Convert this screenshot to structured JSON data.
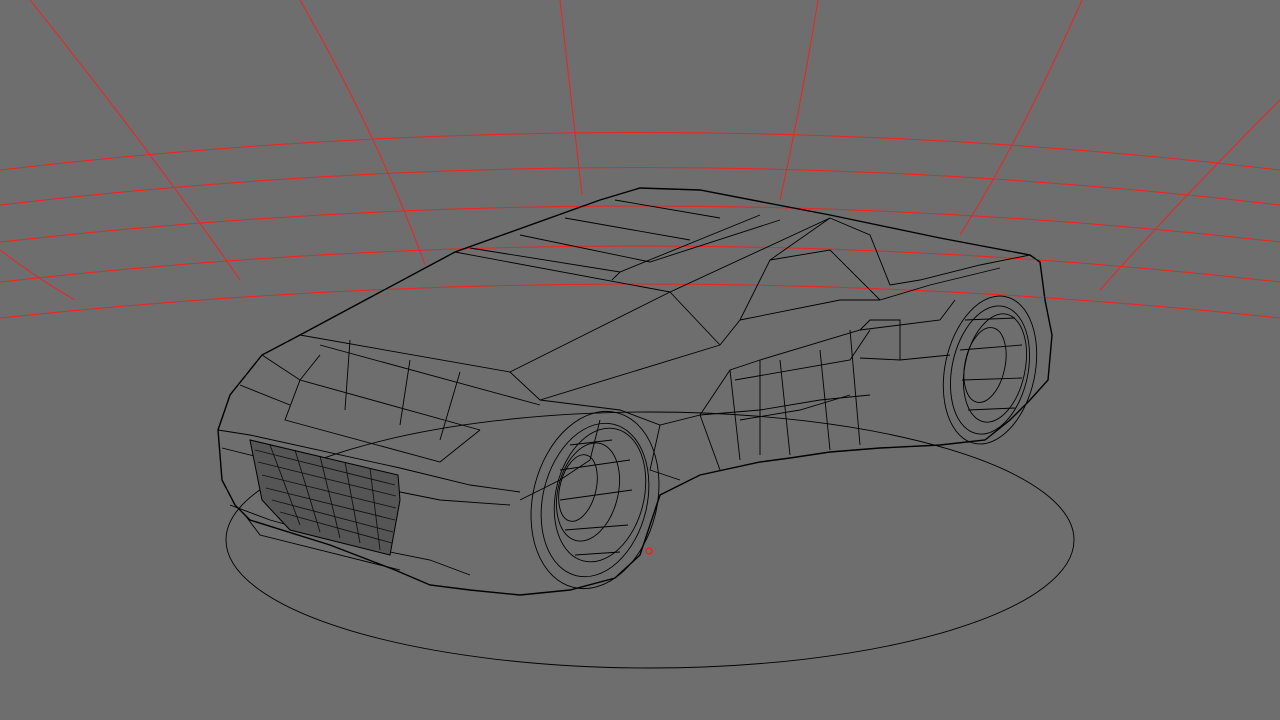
{
  "viewport": {
    "background_color": "#6e6e6e",
    "grid_color": "#ff1a1a",
    "wire_color": "#000000",
    "selected_vertex_color": "#ff1a1a"
  }
}
